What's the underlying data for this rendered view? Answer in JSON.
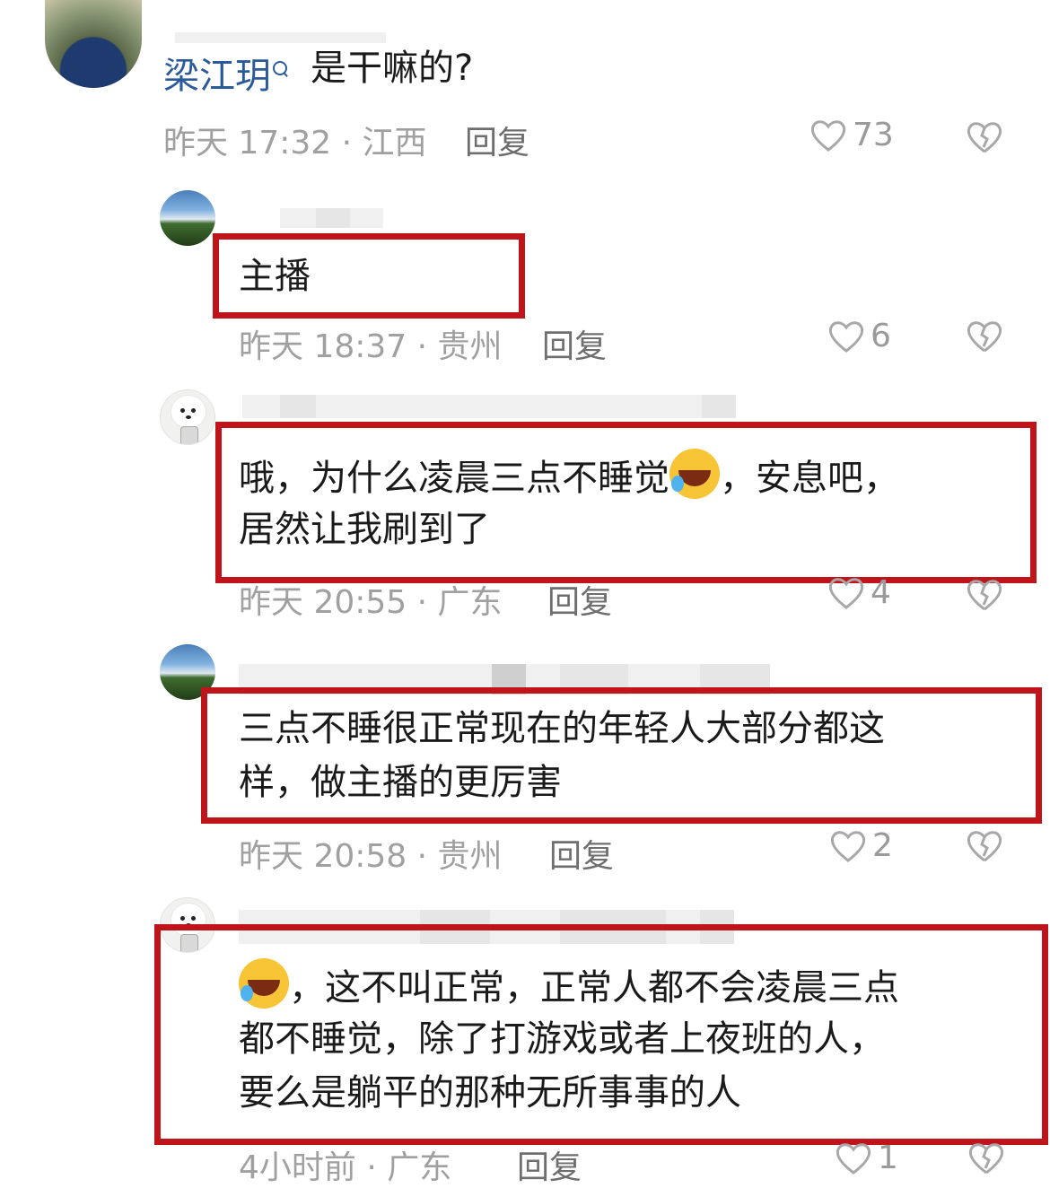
{
  "comments": [
    {
      "user": "梁江玥",
      "text": "是干嘛的?",
      "meta": "昨天 17:32 · 江西",
      "reply": "回复",
      "likes": "73"
    },
    {
      "text": "主播",
      "meta": "昨天 18:37 · 贵州",
      "reply": "回复",
      "likes": "6"
    },
    {
      "text_line1": "哦，为什么凌晨三点不睡觉",
      "text_line1b": "，安息吧，",
      "text_line2": "居然让我刷到了",
      "meta": "昨天 20:55 · 广东",
      "reply": "回复",
      "likes": "4"
    },
    {
      "text_line1": "三点不睡很正常现在的年轻人大部分都这",
      "text_line2": "样，做主播的更厉害",
      "meta": "昨天 20:58 · 贵州",
      "reply": "回复",
      "likes": "2"
    },
    {
      "text_line1": "，这不叫正常，正常人都不会凌晨三点",
      "text_line2": "都不睡觉，除了打游戏或者上夜班的人，",
      "text_line3": "要么是躺平的那种无所事事的人",
      "meta": "4小时前 · 广东",
      "reply": "回复",
      "likes": "1"
    }
  ],
  "icons": {
    "like": "heart-outline-icon",
    "dislike": "broken-heart-icon",
    "emoji": "laughing-crying-emoji",
    "user_search": "search-icon"
  },
  "colors": {
    "highlight_border": "#c0141b",
    "username": "#2b5a9a",
    "meta": "#a0a0a0"
  }
}
